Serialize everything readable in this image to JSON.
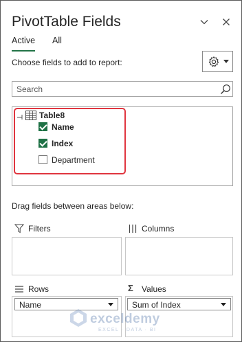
{
  "header": {
    "title": "PivotTable Fields"
  },
  "tabs": [
    {
      "label": "Active"
    },
    {
      "label": "All"
    }
  ],
  "choose_label": "Choose fields to add to report:",
  "search": {
    "placeholder": "Search",
    "value": ""
  },
  "table": {
    "name": "Table8",
    "fields": [
      {
        "label": "Name",
        "checked": true
      },
      {
        "label": "Index",
        "checked": true
      },
      {
        "label": "Department",
        "checked": false
      }
    ]
  },
  "drag_label": "Drag fields between areas below:",
  "areas": {
    "filters": {
      "title": "Filters"
    },
    "columns": {
      "title": "Columns"
    },
    "rows": {
      "title": "Rows",
      "item": "Name"
    },
    "values": {
      "title": "Values",
      "item": "Sum of Index"
    }
  },
  "watermark": {
    "name": "exceldemy",
    "tagline": "EXCEL · DATA · BI"
  },
  "colors": {
    "accent": "#217346",
    "checkbox": "#1e7145",
    "highlight": "#e0353f"
  }
}
